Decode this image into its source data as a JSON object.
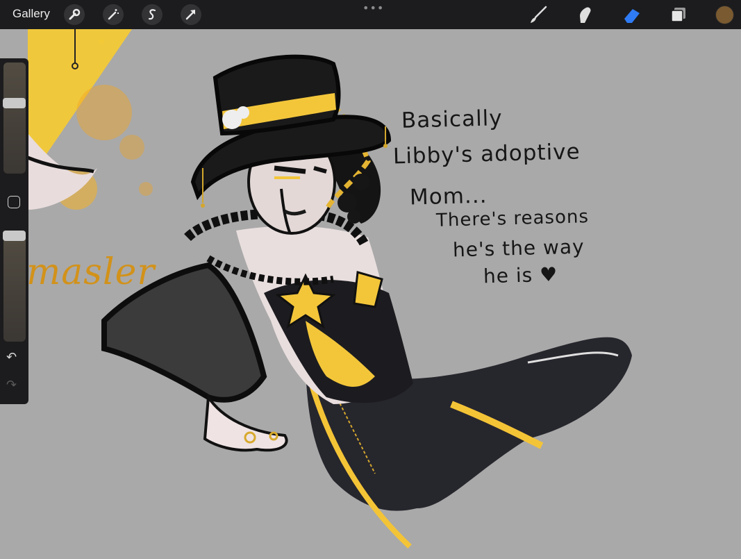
{
  "toolbar": {
    "gallery_label": "Gallery",
    "left_tools": [
      {
        "name": "actions",
        "icon": "wrench-icon"
      },
      {
        "name": "adjustments",
        "icon": "magic-wand-icon"
      },
      {
        "name": "selection",
        "icon": "selection-s-icon"
      },
      {
        "name": "transform",
        "icon": "arrow-cursor-icon"
      }
    ],
    "more_glyph": "•••",
    "right_tools": [
      {
        "name": "brush",
        "icon": "brush-icon"
      },
      {
        "name": "smudge",
        "icon": "smudge-finger-icon"
      },
      {
        "name": "eraser",
        "icon": "eraser-icon",
        "active": true
      },
      {
        "name": "layers",
        "icon": "layers-icon"
      }
    ],
    "current_color": "#7a5a30",
    "active_color": "#2f7bf5"
  },
  "sidebar": {
    "brush_size_level": 0.65,
    "opacity_level": 1.0,
    "undo_glyph": "↶",
    "redo_glyph": "↷"
  },
  "canvas": {
    "background_text": "masler",
    "handwritten_notes": [
      "Basically",
      "Libby's adoptive",
      "Mom...",
      "There's reasons",
      "he's the way",
      "he is ♥"
    ]
  }
}
